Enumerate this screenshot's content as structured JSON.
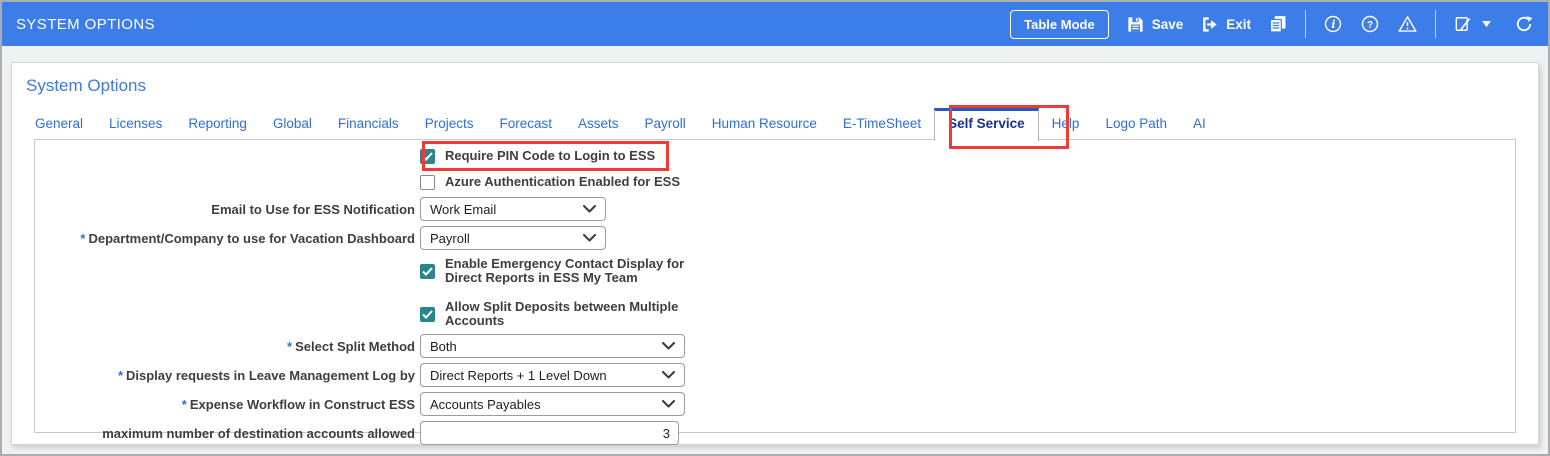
{
  "header": {
    "title": "SYSTEM OPTIONS",
    "table_mode": "Table Mode",
    "save": "Save",
    "exit": "Exit"
  },
  "page_heading": "System Options",
  "tabs": {
    "items": [
      "General",
      "Licenses",
      "Reporting",
      "Global",
      "Financials",
      "Projects",
      "Forecast",
      "Assets",
      "Payroll",
      "Human Resource",
      "E-TimeSheet",
      "Self Service",
      "Help",
      "Logo Path",
      "AI"
    ],
    "active": "Self Service"
  },
  "form": {
    "required_marker": "*",
    "require_pin": {
      "label": "Require PIN Code to Login to ESS",
      "checked": true,
      "highlighted": true
    },
    "azure_auth": {
      "label": "Azure Authentication Enabled for ESS",
      "checked": false
    },
    "ess_email": {
      "label": "Email to Use for ESS Notification",
      "value": "Work Email"
    },
    "vacation_dept": {
      "label": "Department/Company to use for Vacation Dashboard",
      "value": "Payroll",
      "required": true
    },
    "emergency_contact": {
      "label": "Enable Emergency Contact Display for Direct Reports in ESS My Team",
      "checked": true
    },
    "split_deposits": {
      "label": "Allow Split Deposits between Multiple Accounts",
      "checked": true
    },
    "split_method": {
      "label": "Select Split Method",
      "value": "Both",
      "required": true
    },
    "leave_log": {
      "label": "Display requests in Leave Management Log by",
      "value": "Direct Reports + 1 Level Down",
      "required": true
    },
    "expense_workflow": {
      "label": "Expense Workflow in Construct ESS",
      "value": "Accounts Payables",
      "required": true
    },
    "max_accounts": {
      "label": "maximum number of destination accounts allowed",
      "value": "3"
    }
  },
  "colors": {
    "header_blue": "#3d7de9",
    "tab_blue": "#2f6fd6",
    "active_tab_text": "#17328f",
    "active_tab_top_border": "#2458c5",
    "highlight_red": "#ee3b36",
    "checkbox_teal": "#2b858d"
  }
}
